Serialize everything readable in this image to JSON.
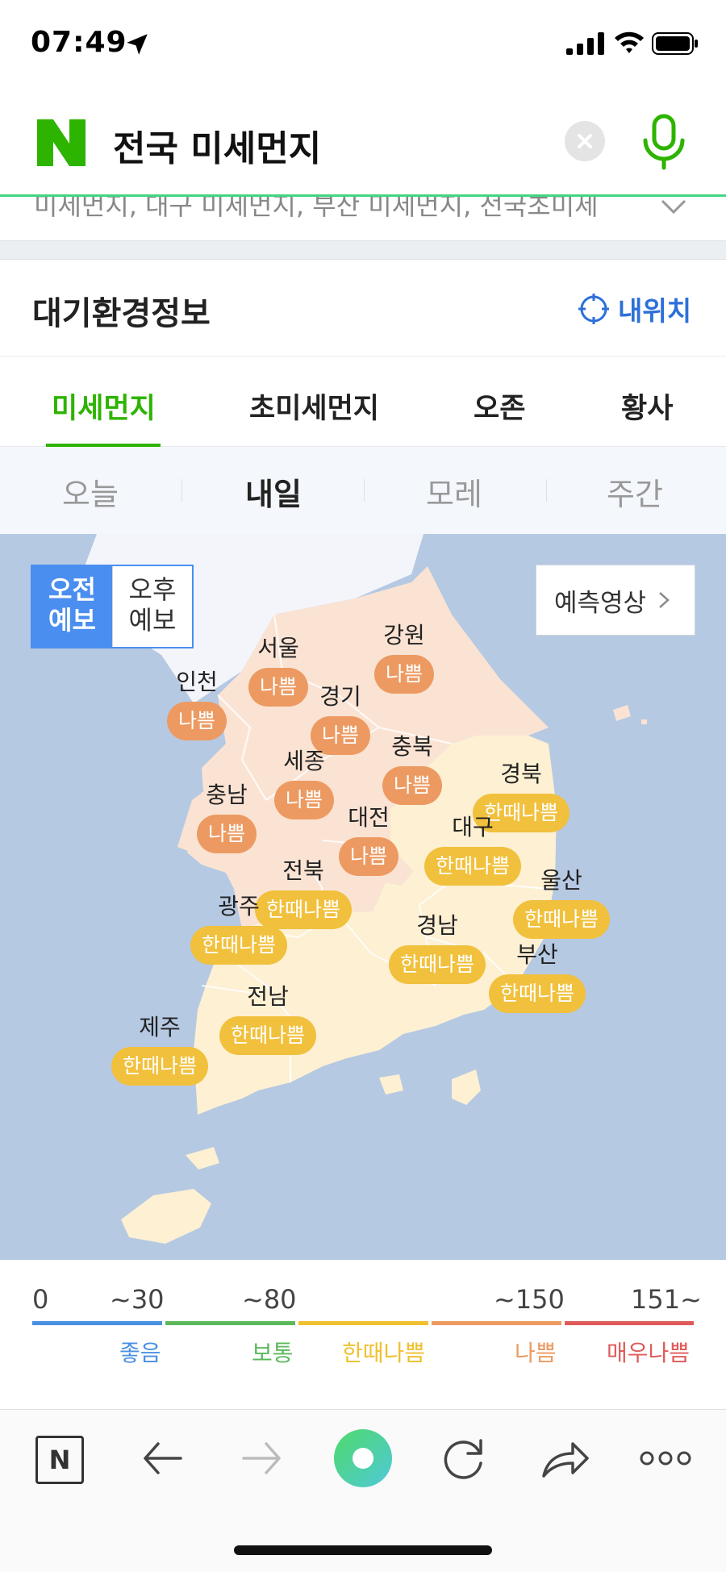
{
  "status": {
    "time": "07:49"
  },
  "search": {
    "logo": "N",
    "query": "전국 미세먼지",
    "suggestions": "미세먼지, 대구 미세먼지, 부산 미세먼지, 전국초미세"
  },
  "section": {
    "title": "대기환경정보",
    "location_button": "내위치"
  },
  "tabs": [
    {
      "label": "미세먼지",
      "active": true
    },
    {
      "label": "초미세먼지",
      "active": false
    },
    {
      "label": "오존",
      "active": false
    },
    {
      "label": "황사",
      "active": false
    }
  ],
  "day_tabs": [
    {
      "label": "오늘",
      "active": false
    },
    {
      "label": "내일",
      "active": true
    },
    {
      "label": "모레",
      "active": false
    },
    {
      "label": "주간",
      "active": false
    }
  ],
  "map": {
    "toggle": {
      "am_line1": "오전",
      "am_line2": "예보",
      "pm_line1": "오후",
      "pm_line2": "예보"
    },
    "predict_button": "예측영상",
    "regions": [
      {
        "name": "강원",
        "status": "나쁨",
        "level": "bad"
      },
      {
        "name": "서울",
        "status": "나쁨",
        "level": "bad"
      },
      {
        "name": "인천",
        "status": "나쁨",
        "level": "bad"
      },
      {
        "name": "경기",
        "status": "나쁨",
        "level": "bad"
      },
      {
        "name": "충북",
        "status": "나쁨",
        "level": "bad"
      },
      {
        "name": "세종",
        "status": "나쁨",
        "level": "bad"
      },
      {
        "name": "경북",
        "status": "한때나쁨",
        "level": "vbad"
      },
      {
        "name": "충남",
        "status": "나쁨",
        "level": "bad"
      },
      {
        "name": "대전",
        "status": "나쁨",
        "level": "bad"
      },
      {
        "name": "대구",
        "status": "한때나쁨",
        "level": "vbad"
      },
      {
        "name": "전북",
        "status": "한때나쁨",
        "level": "vbad"
      },
      {
        "name": "울산",
        "status": "한때나쁨",
        "level": "vbad"
      },
      {
        "name": "광주",
        "status": "한때나쁨",
        "level": "vbad"
      },
      {
        "name": "경남",
        "status": "한때나쁨",
        "level": "vbad"
      },
      {
        "name": "부산",
        "status": "한때나쁨",
        "level": "vbad"
      },
      {
        "name": "전남",
        "status": "한때나쁨",
        "level": "vbad"
      },
      {
        "name": "제주",
        "status": "한때나쁨",
        "level": "vbad"
      }
    ]
  },
  "legend": {
    "numbers": [
      "0",
      "~30",
      "~80",
      "~150",
      "151~"
    ],
    "labels": [
      {
        "text": "좋음",
        "color": "#4a90e2"
      },
      {
        "text": "보통",
        "color": "#5cb85c"
      },
      {
        "text": "한때나쁨",
        "color": "#f0c030"
      },
      {
        "text": "나쁨",
        "color": "#ec9a62"
      },
      {
        "text": "매우나쁨",
        "color": "#e05a5a"
      }
    ]
  },
  "toolbar": {
    "home_label": "N"
  }
}
